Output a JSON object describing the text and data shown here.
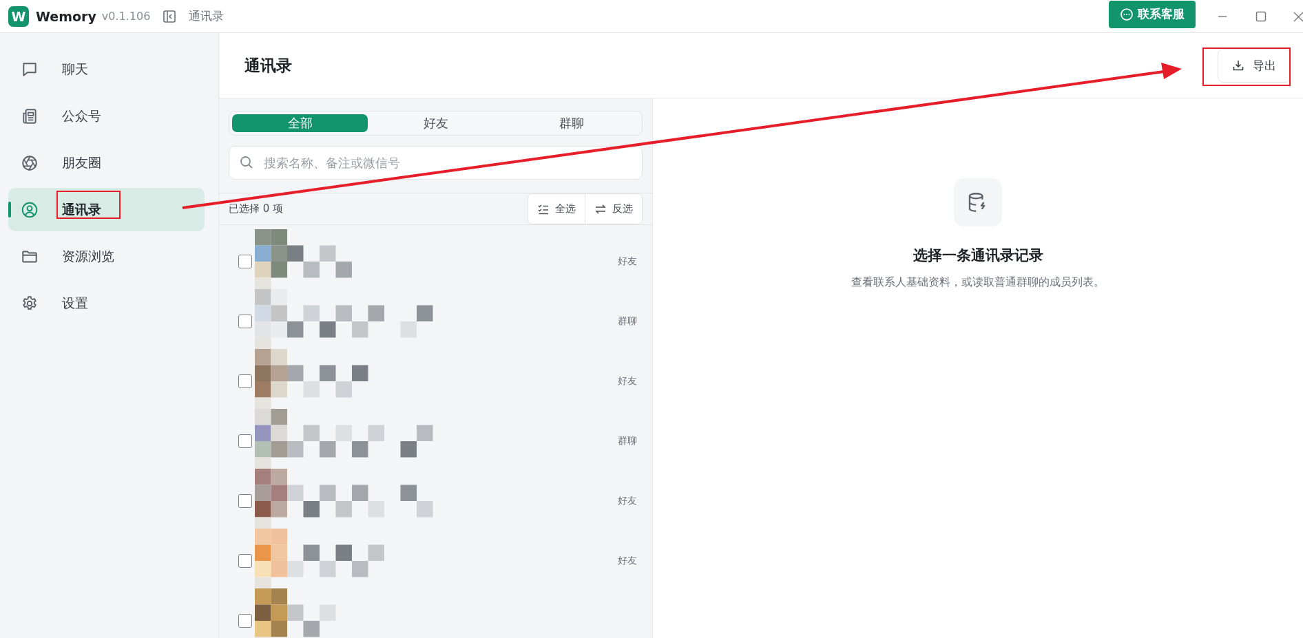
{
  "app": {
    "logo": "W",
    "name": "Wemory",
    "version": "v0.1.106",
    "section": "通讯录",
    "support_button": "联系客服"
  },
  "sidebar": {
    "items": [
      {
        "label": "聊天",
        "kind": "chat",
        "selected": false,
        "highlighted": false
      },
      {
        "label": "公众号",
        "kind": "article",
        "selected": false,
        "highlighted": false
      },
      {
        "label": "朋友圈",
        "kind": "moments",
        "selected": false,
        "highlighted": false
      },
      {
        "label": "通讯录",
        "kind": "contacts",
        "selected": true,
        "highlighted": true
      },
      {
        "label": "资源浏览",
        "kind": "folder",
        "selected": false,
        "highlighted": false
      },
      {
        "label": "设置",
        "kind": "settings",
        "selected": false,
        "highlighted": false
      }
    ]
  },
  "page": {
    "title": "通讯录",
    "export_button": "导出",
    "export_highlighted": true,
    "annotation_arrow": true
  },
  "filter_tabs": [
    {
      "label": "全部",
      "selected": true
    },
    {
      "label": "好友",
      "selected": false
    },
    {
      "label": "群聊",
      "selected": false
    }
  ],
  "search": {
    "placeholder": "搜索名称、备注或微信号"
  },
  "selection": {
    "count_label": "已选择 0 项",
    "select_all": "全选",
    "invert": "反选"
  },
  "contacts": [
    {
      "kind": "picture",
      "type": "好友",
      "checked": false
    },
    {
      "kind": "picture",
      "type": "群聊",
      "checked": false
    },
    {
      "kind": "picture",
      "type": "好友",
      "checked": false
    },
    {
      "kind": "picture",
      "type": "群聊",
      "checked": false
    },
    {
      "kind": "picture",
      "type": "好友",
      "checked": false
    },
    {
      "kind": "picture",
      "type": "好友",
      "checked": false
    },
    {
      "kind": "picture",
      "checked": false
    }
  ],
  "empty_state": {
    "title": "选择一条通讯录记录",
    "subtitle": "查看联系人基础资料，或读取普通群聊的成员列表。"
  }
}
